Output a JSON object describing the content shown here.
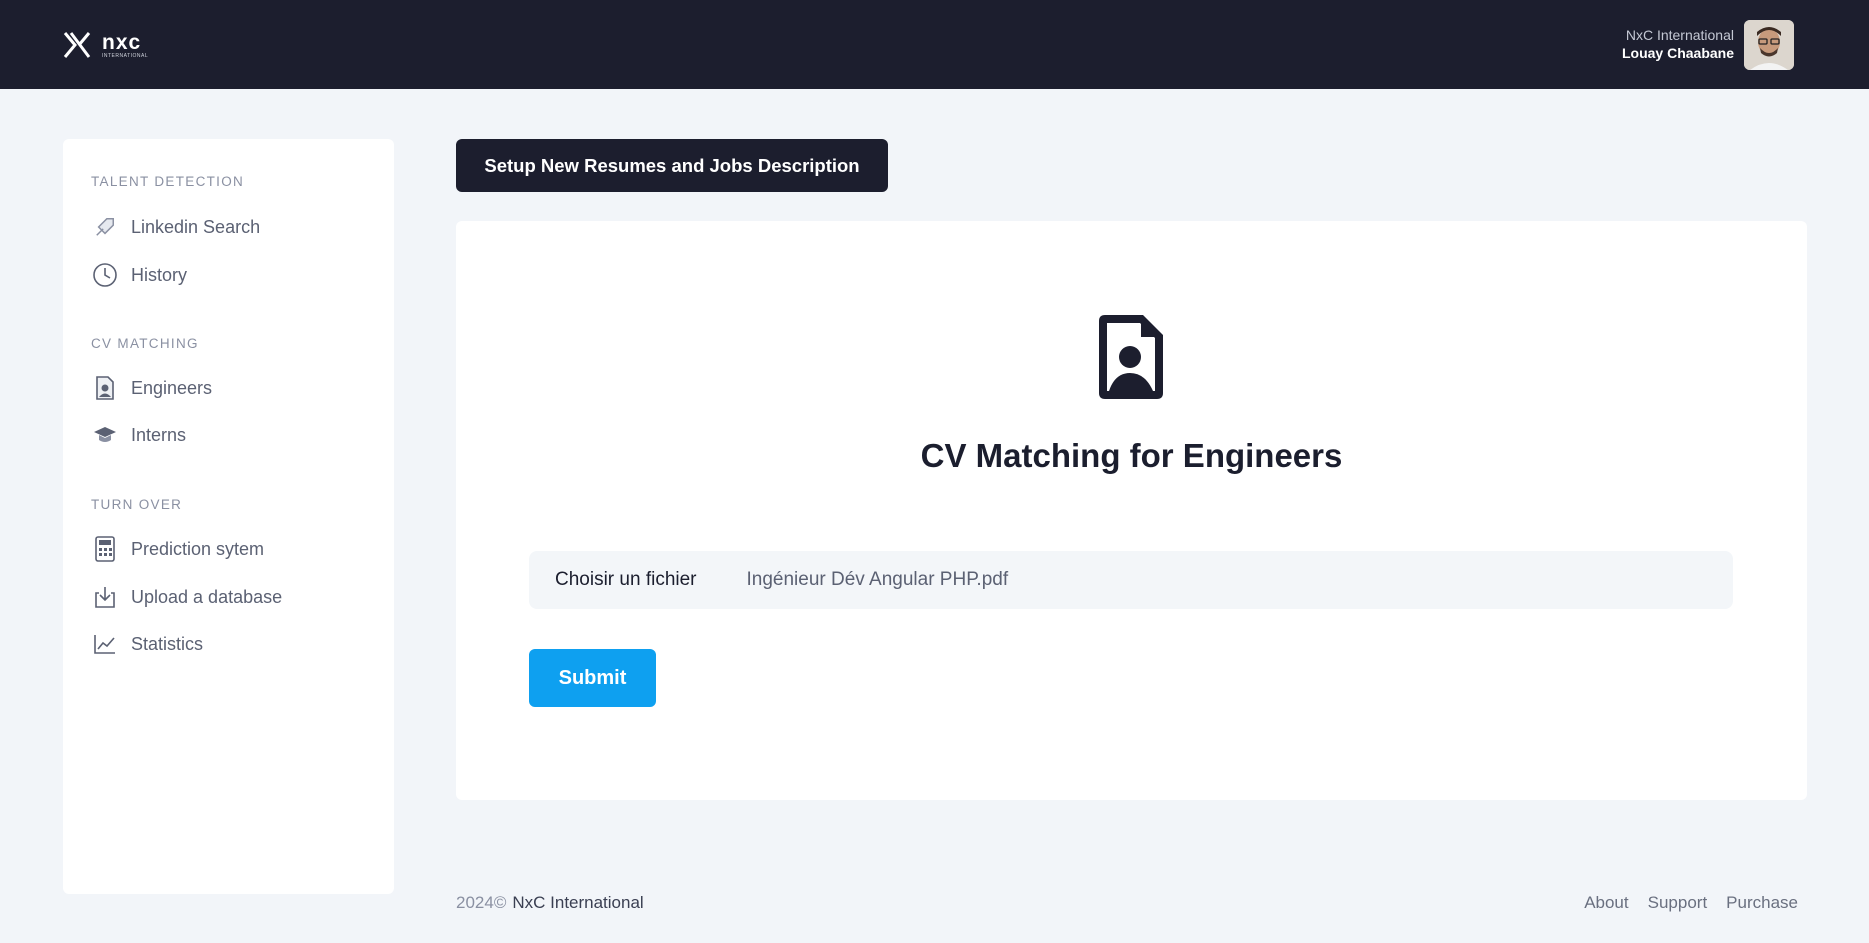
{
  "header": {
    "logo": {
      "word": "nxc",
      "sub": "INTERNATIONAL"
    },
    "user": {
      "org": "NxC International",
      "name": "Louay Chaabane"
    }
  },
  "sidebar": {
    "sections": [
      {
        "title": "TALENT DETECTION",
        "items": [
          {
            "label": "Linkedin Search",
            "icon": "rocket-icon"
          },
          {
            "label": "History",
            "icon": "clock-icon"
          }
        ]
      },
      {
        "title": "CV MATCHING",
        "items": [
          {
            "label": "Engineers",
            "icon": "user-file-icon"
          },
          {
            "label": "Interns",
            "icon": "graduation-cap-icon"
          }
        ]
      },
      {
        "title": "TURN OVER",
        "items": [
          {
            "label": "Prediction sytem",
            "icon": "calculator-icon"
          },
          {
            "label": "Upload a database",
            "icon": "download-icon"
          },
          {
            "label": "Statistics",
            "icon": "chart-line-icon"
          }
        ]
      }
    ]
  },
  "main": {
    "setup_button": "Setup New Resumes and Jobs Description",
    "card": {
      "title": "CV Matching for Engineers",
      "file_button": "Choisir un fichier",
      "file_name": "Ingénieur Dév Angular PHP.pdf",
      "submit": "Submit"
    }
  },
  "footer": {
    "year": "2024©",
    "org": "NxC International",
    "links": [
      "About",
      "Support",
      "Purchase"
    ]
  },
  "colors": {
    "header_bg": "#1c1e2e",
    "page_bg": "#f2f5f9",
    "accent": "#0ea0f0"
  }
}
